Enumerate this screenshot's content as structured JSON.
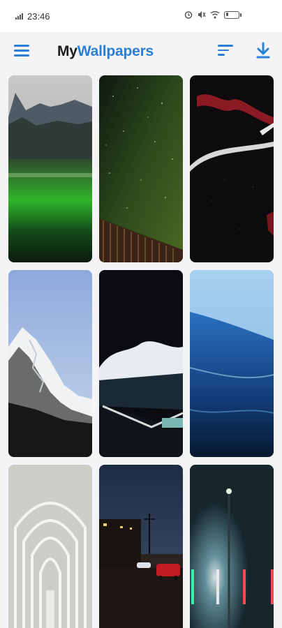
{
  "status_bar": {
    "time": "23:46",
    "icons": [
      "signal-icon",
      "alarm-icon",
      "mute-icon",
      "wifi-icon",
      "battery-icon"
    ]
  },
  "app_bar": {
    "title_part1": "My",
    "title_part2": "Wallpapers",
    "menu_icon": "hamburger-menu-icon",
    "sort_icon": "sort-icon",
    "download_icon": "download-icon",
    "accent_color": "#2a7fd6"
  },
  "wallpapers": [
    {
      "subject": "green valley with mountains"
    },
    {
      "subject": "starry night sky over wooden fence"
    },
    {
      "subject": "abstract red and white light streaks on black"
    },
    {
      "subject": "snowy mountain peak"
    },
    {
      "subject": "ocean wave crashing at night pool"
    },
    {
      "subject": "blue ocean wave"
    },
    {
      "subject": "white gothic arches"
    },
    {
      "subject": "city street at dusk with red car"
    },
    {
      "subject": "foggy night with street light and neon posts"
    }
  ]
}
